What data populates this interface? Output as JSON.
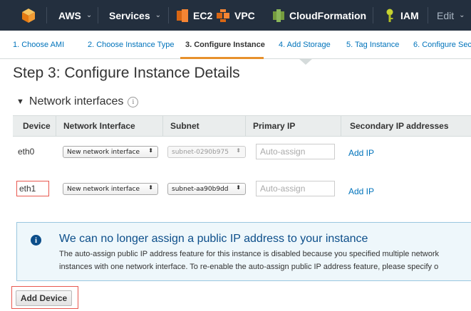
{
  "topnav": {
    "aws_label": "AWS",
    "services_label": "Services",
    "ec2_label": "EC2",
    "vpc_label": "VPC",
    "cloudformation_label": "CloudFormation",
    "iam_label": "IAM",
    "edit_label": "Edit",
    "caret": "⌄"
  },
  "wizard": {
    "tabs": [
      {
        "label": "1. Choose AMI"
      },
      {
        "label": "2. Choose Instance Type"
      },
      {
        "label": "3. Configure Instance"
      },
      {
        "label": "4. Add Storage"
      },
      {
        "label": "5. Tag Instance"
      },
      {
        "label": "6. Configure Secu"
      }
    ],
    "active_tab": "3. Configure Instance"
  },
  "page_title": "Step 3: Configure Instance Details",
  "section": {
    "title": "Network interfaces",
    "toggle_glyph": "▼",
    "info_glyph": "i"
  },
  "table": {
    "headers": [
      "Device",
      "Network Interface",
      "Subnet",
      "Primary IP",
      "Secondary IP addresses"
    ],
    "rows": [
      {
        "device": "eth0",
        "network_interface": "New network interface",
        "subnet": "subnet-0290b975",
        "primary_ip_placeholder": "Auto-assign",
        "secondary_action": "Add IP"
      },
      {
        "device": "eth1",
        "network_interface": "New network interface",
        "subnet": "subnet-aa90b9dd",
        "primary_ip_placeholder": "Auto-assign",
        "secondary_action": "Add IP"
      }
    ],
    "select_arrow": "⬍"
  },
  "alert": {
    "icon_glyph": "i",
    "title": "We can no longer assign a public IP address to your instance",
    "line1": "The auto-assign public IP address feature for this instance is disabled because you specified multiple network",
    "line2": "instances with one network interface. To re-enable the auto-assign public IP address feature, please specify o"
  },
  "add_device_label": "Add Device",
  "colors": {
    "nav_bg": "#232f3e",
    "link": "#0073bb",
    "active_tab_underline": "#e7912c",
    "highlight_box": "#e8584f",
    "alert_title": "#0c4e8a"
  }
}
